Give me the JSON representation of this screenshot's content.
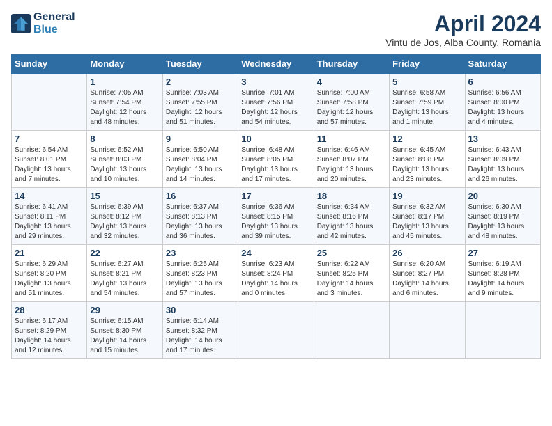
{
  "header": {
    "logo_line1": "General",
    "logo_line2": "Blue",
    "month_title": "April 2024",
    "location": "Vintu de Jos, Alba County, Romania"
  },
  "weekdays": [
    "Sunday",
    "Monday",
    "Tuesday",
    "Wednesday",
    "Thursday",
    "Friday",
    "Saturday"
  ],
  "weeks": [
    [
      {
        "day": "",
        "sunrise": "",
        "sunset": "",
        "daylight": ""
      },
      {
        "day": "1",
        "sunrise": "Sunrise: 7:05 AM",
        "sunset": "Sunset: 7:54 PM",
        "daylight": "Daylight: 12 hours and 48 minutes."
      },
      {
        "day": "2",
        "sunrise": "Sunrise: 7:03 AM",
        "sunset": "Sunset: 7:55 PM",
        "daylight": "Daylight: 12 hours and 51 minutes."
      },
      {
        "day": "3",
        "sunrise": "Sunrise: 7:01 AM",
        "sunset": "Sunset: 7:56 PM",
        "daylight": "Daylight: 12 hours and 54 minutes."
      },
      {
        "day": "4",
        "sunrise": "Sunrise: 7:00 AM",
        "sunset": "Sunset: 7:58 PM",
        "daylight": "Daylight: 12 hours and 57 minutes."
      },
      {
        "day": "5",
        "sunrise": "Sunrise: 6:58 AM",
        "sunset": "Sunset: 7:59 PM",
        "daylight": "Daylight: 13 hours and 1 minute."
      },
      {
        "day": "6",
        "sunrise": "Sunrise: 6:56 AM",
        "sunset": "Sunset: 8:00 PM",
        "daylight": "Daylight: 13 hours and 4 minutes."
      }
    ],
    [
      {
        "day": "7",
        "sunrise": "Sunrise: 6:54 AM",
        "sunset": "Sunset: 8:01 PM",
        "daylight": "Daylight: 13 hours and 7 minutes."
      },
      {
        "day": "8",
        "sunrise": "Sunrise: 6:52 AM",
        "sunset": "Sunset: 8:03 PM",
        "daylight": "Daylight: 13 hours and 10 minutes."
      },
      {
        "day": "9",
        "sunrise": "Sunrise: 6:50 AM",
        "sunset": "Sunset: 8:04 PM",
        "daylight": "Daylight: 13 hours and 14 minutes."
      },
      {
        "day": "10",
        "sunrise": "Sunrise: 6:48 AM",
        "sunset": "Sunset: 8:05 PM",
        "daylight": "Daylight: 13 hours and 17 minutes."
      },
      {
        "day": "11",
        "sunrise": "Sunrise: 6:46 AM",
        "sunset": "Sunset: 8:07 PM",
        "daylight": "Daylight: 13 hours and 20 minutes."
      },
      {
        "day": "12",
        "sunrise": "Sunrise: 6:45 AM",
        "sunset": "Sunset: 8:08 PM",
        "daylight": "Daylight: 13 hours and 23 minutes."
      },
      {
        "day": "13",
        "sunrise": "Sunrise: 6:43 AM",
        "sunset": "Sunset: 8:09 PM",
        "daylight": "Daylight: 13 hours and 26 minutes."
      }
    ],
    [
      {
        "day": "14",
        "sunrise": "Sunrise: 6:41 AM",
        "sunset": "Sunset: 8:11 PM",
        "daylight": "Daylight: 13 hours and 29 minutes."
      },
      {
        "day": "15",
        "sunrise": "Sunrise: 6:39 AM",
        "sunset": "Sunset: 8:12 PM",
        "daylight": "Daylight: 13 hours and 32 minutes."
      },
      {
        "day": "16",
        "sunrise": "Sunrise: 6:37 AM",
        "sunset": "Sunset: 8:13 PM",
        "daylight": "Daylight: 13 hours and 36 minutes."
      },
      {
        "day": "17",
        "sunrise": "Sunrise: 6:36 AM",
        "sunset": "Sunset: 8:15 PM",
        "daylight": "Daylight: 13 hours and 39 minutes."
      },
      {
        "day": "18",
        "sunrise": "Sunrise: 6:34 AM",
        "sunset": "Sunset: 8:16 PM",
        "daylight": "Daylight: 13 hours and 42 minutes."
      },
      {
        "day": "19",
        "sunrise": "Sunrise: 6:32 AM",
        "sunset": "Sunset: 8:17 PM",
        "daylight": "Daylight: 13 hours and 45 minutes."
      },
      {
        "day": "20",
        "sunrise": "Sunrise: 6:30 AM",
        "sunset": "Sunset: 8:19 PM",
        "daylight": "Daylight: 13 hours and 48 minutes."
      }
    ],
    [
      {
        "day": "21",
        "sunrise": "Sunrise: 6:29 AM",
        "sunset": "Sunset: 8:20 PM",
        "daylight": "Daylight: 13 hours and 51 minutes."
      },
      {
        "day": "22",
        "sunrise": "Sunrise: 6:27 AM",
        "sunset": "Sunset: 8:21 PM",
        "daylight": "Daylight: 13 hours and 54 minutes."
      },
      {
        "day": "23",
        "sunrise": "Sunrise: 6:25 AM",
        "sunset": "Sunset: 8:23 PM",
        "daylight": "Daylight: 13 hours and 57 minutes."
      },
      {
        "day": "24",
        "sunrise": "Sunrise: 6:23 AM",
        "sunset": "Sunset: 8:24 PM",
        "daylight": "Daylight: 14 hours and 0 minutes."
      },
      {
        "day": "25",
        "sunrise": "Sunrise: 6:22 AM",
        "sunset": "Sunset: 8:25 PM",
        "daylight": "Daylight: 14 hours and 3 minutes."
      },
      {
        "day": "26",
        "sunrise": "Sunrise: 6:20 AM",
        "sunset": "Sunset: 8:27 PM",
        "daylight": "Daylight: 14 hours and 6 minutes."
      },
      {
        "day": "27",
        "sunrise": "Sunrise: 6:19 AM",
        "sunset": "Sunset: 8:28 PM",
        "daylight": "Daylight: 14 hours and 9 minutes."
      }
    ],
    [
      {
        "day": "28",
        "sunrise": "Sunrise: 6:17 AM",
        "sunset": "Sunset: 8:29 PM",
        "daylight": "Daylight: 14 hours and 12 minutes."
      },
      {
        "day": "29",
        "sunrise": "Sunrise: 6:15 AM",
        "sunset": "Sunset: 8:30 PM",
        "daylight": "Daylight: 14 hours and 15 minutes."
      },
      {
        "day": "30",
        "sunrise": "Sunrise: 6:14 AM",
        "sunset": "Sunset: 8:32 PM",
        "daylight": "Daylight: 14 hours and 17 minutes."
      },
      {
        "day": "",
        "sunrise": "",
        "sunset": "",
        "daylight": ""
      },
      {
        "day": "",
        "sunrise": "",
        "sunset": "",
        "daylight": ""
      },
      {
        "day": "",
        "sunrise": "",
        "sunset": "",
        "daylight": ""
      },
      {
        "day": "",
        "sunrise": "",
        "sunset": "",
        "daylight": ""
      }
    ]
  ]
}
